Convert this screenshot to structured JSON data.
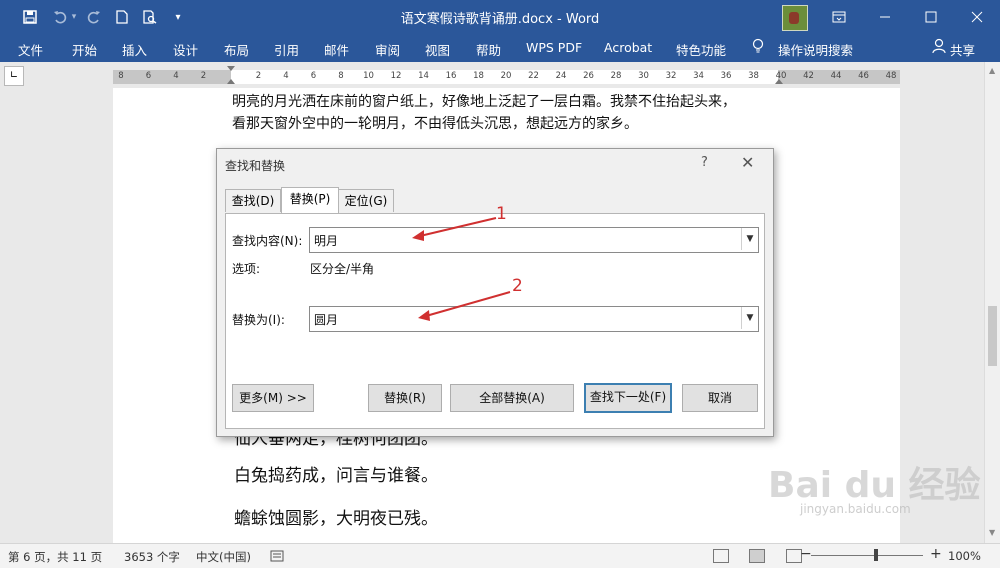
{
  "titlebar": {
    "doc_title": "语文寒假诗歌背诵册.docx - Word",
    "icons": [
      "save-icon",
      "undo-icon",
      "redo-icon",
      "new-doc-icon",
      "print-preview-icon",
      "customize-icon"
    ],
    "window_buttons": [
      "ribbon-display-icon",
      "minimize-icon",
      "maximize-icon",
      "close-icon"
    ]
  },
  "menu": {
    "items": [
      "文件",
      "开始",
      "插入",
      "设计",
      "布局",
      "引用",
      "邮件",
      "审阅",
      "视图",
      "帮助",
      "WPS PDF",
      "Acrobat",
      "特色功能",
      "操作说明搜索",
      "共享"
    ]
  },
  "ruler": {
    "ticks": [
      "8",
      "6",
      "4",
      "2",
      "2",
      "4",
      "6",
      "8",
      "10",
      "12",
      "14",
      "16",
      "18",
      "20",
      "22",
      "24",
      "26",
      "28",
      "30",
      "32",
      "34",
      "36",
      "38",
      "40",
      "42",
      "44",
      "46",
      "48"
    ]
  },
  "document": {
    "line1": "明亮的月光洒在床前的窗户纸上，好像地上泛起了一层白霜。我禁不住抬起头来，",
    "line2": "看那天窗外空中的一轮明月，不由得低头沉思，想起远方的家乡。",
    "line3": "仙人垂两足，桂树何团团。",
    "line4": "白兔捣药成，问言与谁餐。",
    "line5": "蟾蜍蚀圆影，大明夜已残。"
  },
  "dialog": {
    "title": "查找和替换",
    "help": "?",
    "close": "✕",
    "tabs": [
      "查找(D)",
      "替换(P)",
      "定位(G)"
    ],
    "find_label": "查找内容(N):",
    "find_value": "明月",
    "options_label": "选项:",
    "options_value": "区分全/半角",
    "replace_label": "替换为(I):",
    "replace_value": "圆月",
    "buttons": {
      "more": "更多(M) >>",
      "replace": "替换(R)",
      "replace_all": "全部替换(A)",
      "find_next": "查找下一处(F)",
      "cancel": "取消"
    }
  },
  "annotations": {
    "first": "1",
    "second": "2",
    "color": "#d03030"
  },
  "status": {
    "page": "第 6 页，共 11 页",
    "words": "3653 个字",
    "language": "中文(中国)",
    "zoom": "100%",
    "zoom_minus": "−",
    "zoom_plus": "+"
  },
  "watermark": {
    "brand": "Bai du 经验",
    "url": "jingyan.baidu.com"
  },
  "colors": {
    "titlebar": "#2b579a",
    "accent": "#3c7fb1"
  }
}
